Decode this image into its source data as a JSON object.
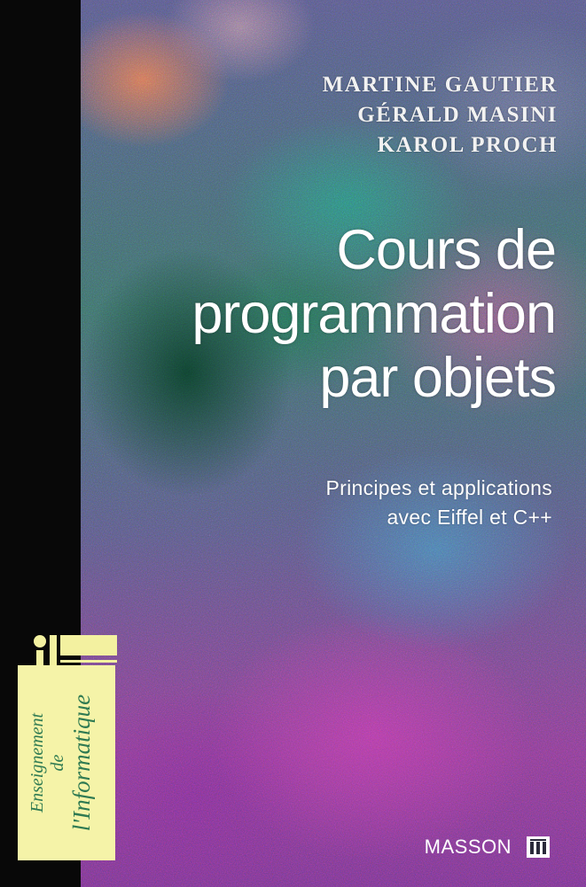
{
  "authors": [
    "MARTINE GAUTIER",
    "GÉRALD MASINI",
    "KAROL PROCH"
  ],
  "title_lines": [
    "Cours de",
    "programmation",
    "par objets"
  ],
  "subtitle_lines": [
    "Principes et applications",
    "avec Eiffel et C++"
  ],
  "series": {
    "line1": "Enseignement",
    "line2": "de",
    "line3": "l'Informatique"
  },
  "publisher": "MASSON",
  "colors": {
    "spine": "#080808",
    "series_panel": "#f5f3a8",
    "series_text": "#2f7a52",
    "text": "#ffffff"
  },
  "icons": {
    "series_logo": "series-logo-icon",
    "publisher_logo": "publisher-logo-icon"
  }
}
